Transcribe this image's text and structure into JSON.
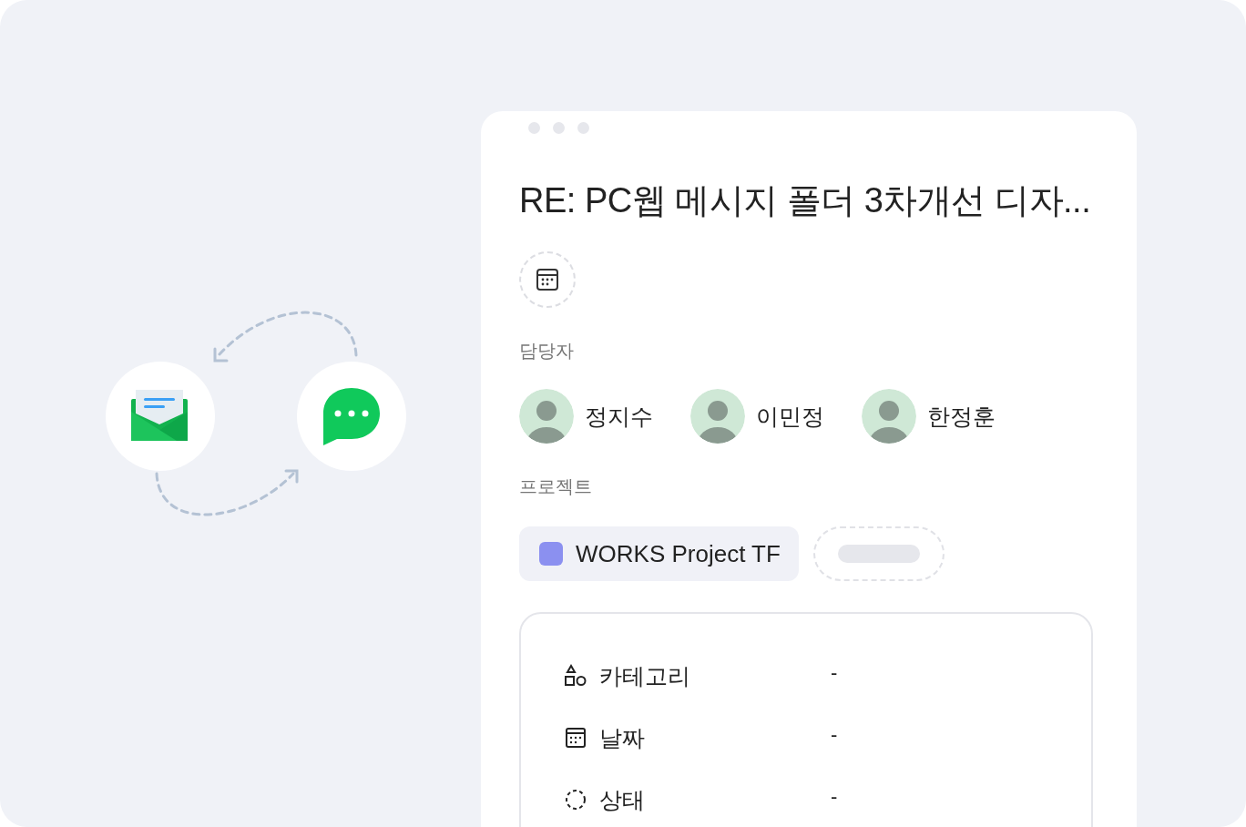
{
  "task": {
    "title": "RE: PC웹 메시지 폴더 3차개선 디자...",
    "assignee_label": "담당자",
    "assignees": [
      {
        "name": "정지수"
      },
      {
        "name": "이민정"
      },
      {
        "name": "한정훈"
      }
    ],
    "project_label": "프로젝트",
    "project": {
      "name": "WORKS Project TF",
      "color": "#8b90f0"
    },
    "properties": [
      {
        "kind": "category",
        "label": "카테고리",
        "value": "-"
      },
      {
        "kind": "date",
        "label": "날짜",
        "value": "-"
      },
      {
        "kind": "status",
        "label": "상태",
        "value": "-"
      }
    ]
  }
}
